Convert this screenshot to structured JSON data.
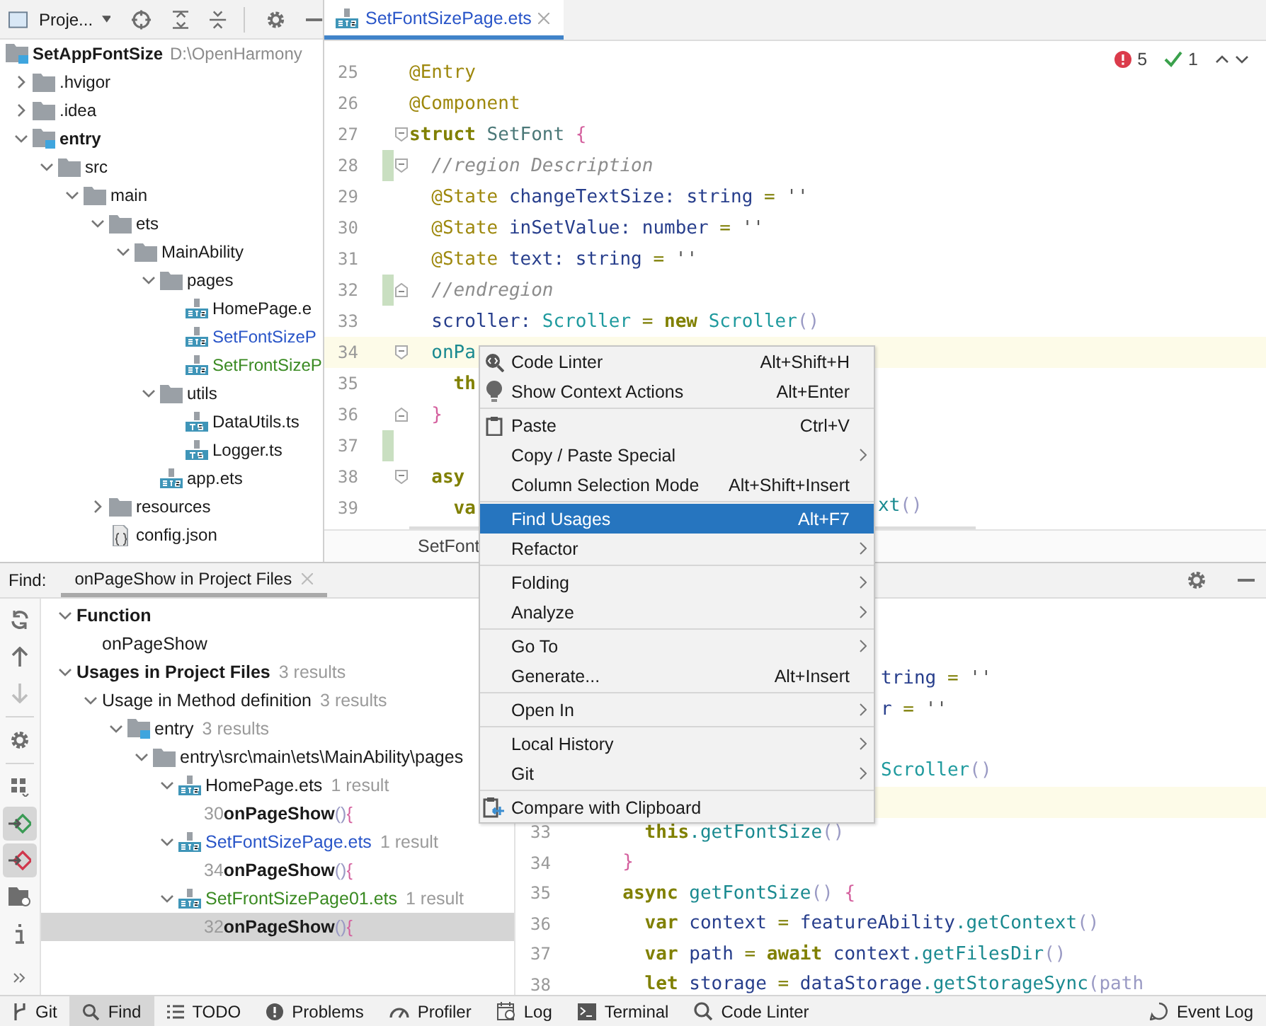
{
  "project": {
    "title": "Proje...",
    "tree": [
      {
        "name": "SetAppFontSize",
        "kind": "project",
        "path": "D:\\OpenHarmony",
        "color": "#1a1a1a",
        "children": [
          {
            "name": ".hvigor",
            "kind": "folder",
            "color": "#1a1a1a",
            "expanded": false
          },
          {
            "name": ".idea",
            "kind": "folder",
            "color": "#1a1a1a",
            "expanded": false
          },
          {
            "name": "entry",
            "kind": "module",
            "color": "#1a1a1a",
            "expanded": true,
            "children": [
              {
                "name": "src",
                "kind": "folder",
                "color": "#1a1a1a",
                "expanded": true,
                "children": [
                  {
                    "name": "main",
                    "kind": "folder",
                    "color": "#1a1a1a",
                    "expanded": true,
                    "children": [
                      {
                        "name": "ets",
                        "kind": "folder",
                        "color": "#1a1a1a",
                        "expanded": true,
                        "children": [
                          {
                            "name": "MainAbility",
                            "kind": "folder",
                            "color": "#1a1a1a",
                            "expanded": true,
                            "children": [
                              {
                                "name": "pages",
                                "kind": "folder",
                                "color": "#1a1a1a",
                                "expanded": true,
                                "children": [
                                  {
                                    "name": "HomePage.e",
                                    "kind": "ets",
                                    "color": "#1a1a1a"
                                  },
                                  {
                                    "name": "SetFontSizeP",
                                    "kind": "ets",
                                    "color": "#2955c8"
                                  },
                                  {
                                    "name": "SetFrontSizeP",
                                    "kind": "ets",
                                    "color": "#3a8a22"
                                  }
                                ]
                              },
                              {
                                "name": "utils",
                                "kind": "folder",
                                "color": "#1a1a1a",
                                "expanded": true,
                                "children": [
                                  {
                                    "name": "DataUtils.ts",
                                    "kind": "ts",
                                    "color": "#1a1a1a"
                                  },
                                  {
                                    "name": "Logger.ts",
                                    "kind": "ts",
                                    "color": "#1a1a1a"
                                  }
                                ]
                              },
                              {
                                "name": "app.ets",
                                "kind": "ets",
                                "color": "#1a1a1a"
                              }
                            ]
                          }
                        ]
                      },
                      {
                        "name": "resources",
                        "kind": "folder",
                        "color": "#1a1a1a",
                        "expanded": false
                      },
                      {
                        "name": "config.json",
                        "kind": "json",
                        "color": "#1a1a1a"
                      }
                    ]
                  }
                ]
              }
            ]
          }
        ]
      }
    ]
  },
  "editor": {
    "tabs": [
      {
        "label": "SetFontSizePage.ets",
        "selected": true
      }
    ],
    "inspections": {
      "errors": "5",
      "checks": "1"
    },
    "lines": [
      {
        "n": "25",
        "code": [
          {
            "text": "@Entry",
            "kind": "dec"
          }
        ]
      },
      {
        "n": "26",
        "code": [
          {
            "text": "@Component",
            "kind": "dec"
          }
        ]
      },
      {
        "n": "27",
        "fold_open": true,
        "code": [
          {
            "text": "struct ",
            "kind": "kw"
          },
          {
            "text": "SetFont ",
            "kind": "name"
          },
          {
            "text": "{",
            "kind": "brace"
          }
        ]
      },
      {
        "n": "28",
        "fold_open": true,
        "changed": true,
        "code": [
          {
            "text": "  //region Description",
            "kind": "cm"
          }
        ]
      },
      {
        "n": "29",
        "code": [
          {
            "text": "  @State ",
            "kind": "dec"
          },
          {
            "text": "changeTextSize: ",
            "kind": "id"
          },
          {
            "text": "string",
            "kind": "type"
          },
          {
            "text": " = ",
            "kind": "op"
          },
          {
            "text": "''",
            "kind": "str"
          }
        ]
      },
      {
        "n": "30",
        "code": [
          {
            "text": "  @State ",
            "kind": "dec"
          },
          {
            "text": "inSetValue: ",
            "kind": "id"
          },
          {
            "text": "number",
            "kind": "type"
          },
          {
            "text": " = ",
            "kind": "op"
          },
          {
            "text": "''",
            "kind": "str"
          }
        ]
      },
      {
        "n": "31",
        "code": [
          {
            "text": "  @State ",
            "kind": "dec"
          },
          {
            "text": "text: ",
            "kind": "id"
          },
          {
            "text": "string",
            "kind": "type"
          },
          {
            "text": " = ",
            "kind": "op"
          },
          {
            "text": "''",
            "kind": "str"
          }
        ]
      },
      {
        "n": "32",
        "fold_close": true,
        "changed": true,
        "code": [
          {
            "text": "  //endregion",
            "kind": "cm"
          }
        ]
      },
      {
        "n": "33",
        "code": [
          {
            "text": "  scroller: ",
            "kind": "id"
          },
          {
            "text": "Scroller",
            "kind": "cls"
          },
          {
            "text": " = ",
            "kind": "op"
          },
          {
            "text": "new ",
            "kind": "kw"
          },
          {
            "text": "Scroller",
            "kind": "cls"
          },
          {
            "text": "()",
            "kind": "paren"
          }
        ]
      },
      {
        "n": "34",
        "fold_open": true,
        "current": true,
        "code": [
          {
            "text": "  onPa",
            "kind": "fn"
          }
        ]
      },
      {
        "n": "35",
        "code": [
          {
            "text": "    th",
            "kind": "kw"
          }
        ]
      },
      {
        "n": "36",
        "fold_close": true,
        "code": [
          {
            "text": "  }",
            "kind": "brace"
          }
        ]
      },
      {
        "n": "37",
        "changed": true
      },
      {
        "n": "38",
        "fold_open": true,
        "code": [
          {
            "text": "  asy",
            "kind": "kw"
          }
        ]
      },
      {
        "n": "39",
        "code": [
          {
            "text": "    va",
            "kind": "kw"
          }
        ],
        "after_menu": [
          {
            "text": "xt",
            "kind": "fn"
          },
          {
            "text": "()",
            "kind": "paren"
          }
        ]
      }
    ],
    "breadcrumb": "SetFont"
  },
  "find": {
    "label": "Find:",
    "tabs": [
      {
        "label": "onPageShow in Project Files",
        "selected": true
      }
    ],
    "toolbar": [
      {
        "kind": "rerun",
        "selected": false,
        "disabled": false
      },
      {
        "kind": "up",
        "selected": false,
        "disabled": false
      },
      {
        "kind": "down",
        "selected": false,
        "disabled": true
      },
      {
        "kind": "settings",
        "selected": false,
        "disabled": false
      },
      {
        "kind": "group",
        "selected": false,
        "disabled": false
      },
      {
        "kind": "read",
        "selected": true,
        "disabled": false
      },
      {
        "kind": "write",
        "selected": true,
        "disabled": false
      },
      {
        "kind": "folder",
        "selected": false,
        "disabled": false
      },
      {
        "kind": "info",
        "selected": false,
        "disabled": false
      }
    ],
    "results": [
      {
        "kind": "category",
        "label": "Function",
        "expanded": true,
        "selected": false,
        "children": [
          {
            "label": "onPageShow",
            "selected": false
          }
        ]
      },
      {
        "kind": "category",
        "label": "Usages in Project Files",
        "count": "3 results",
        "expanded": true,
        "selected": false,
        "children": [
          {
            "label": "Usage in Method definition",
            "count": "3 results",
            "expanded": true,
            "selected": false,
            "children": [
              {
                "kind": "module",
                "label": "entry",
                "count": "3 results",
                "expanded": true,
                "selected": false,
                "children": [
                  {
                    "kind": "folder",
                    "label": "entry\\src\\main\\ets\\MainAbility\\pages",
                    "expanded": true,
                    "selected": false,
                    "children": [
                      {
                        "kind": "ets",
                        "label": "HomePage.ets",
                        "color": "#1a1a1a",
                        "count": "1 result",
                        "expanded": true,
                        "selected": false,
                        "children": [
                          {
                            "kind": "usage",
                            "line": "30",
                            "match": "onPageShow",
                            "paren": "()",
                            "brace": "{",
                            "selected": false
                          }
                        ]
                      },
                      {
                        "kind": "ets",
                        "label": "SetFontSizePage.ets",
                        "color": "#2955c8",
                        "count": "1 result",
                        "expanded": true,
                        "selected": false,
                        "children": [
                          {
                            "kind": "usage",
                            "line": "34",
                            "match": "onPageShow",
                            "paren": "()",
                            "brace": "{",
                            "selected": false
                          }
                        ]
                      },
                      {
                        "kind": "ets",
                        "label": "SetFrontSizePage01.ets",
                        "color": "#3a8a22",
                        "count": "1 result",
                        "expanded": true,
                        "selected": false,
                        "children": [
                          {
                            "kind": "usage",
                            "line": "32",
                            "match": "onPageShow",
                            "paren": "()",
                            "brace": "{",
                            "selected": true
                          }
                        ]
                      }
                    ]
                  }
                ]
              }
            ]
          }
        ]
      }
    ],
    "preview": [
      {
        "current": false,
        "after_menu": [
          {
            "text": "tring",
            "kind": "type"
          },
          {
            "text": " = ",
            "kind": "op"
          },
          {
            "text": "''",
            "kind": "str"
          }
        ]
      },
      {
        "current": false,
        "after_menu": [
          {
            "text": "r",
            "kind": "type"
          },
          {
            "text": " = ",
            "kind": "op"
          },
          {
            "text": "''",
            "kind": "str"
          }
        ]
      },
      {
        "current": false
      },
      {
        "current": false,
        "after_menu": [
          {
            "text": "Scroller",
            "kind": "cls"
          },
          {
            "text": "()",
            "kind": "paren"
          }
        ]
      },
      {
        "current": true
      },
      {
        "n": "33",
        "current": false,
        "code": [
          {
            "text": "    this",
            "kind": "kw"
          },
          {
            "text": ".getFontSize",
            "kind": "fn"
          },
          {
            "text": "()",
            "kind": "paren"
          }
        ]
      },
      {
        "n": "34",
        "current": false,
        "code": [
          {
            "text": "  }",
            "kind": "brace"
          }
        ]
      },
      {
        "n": "35",
        "current": false,
        "code": [
          {
            "text": "  async ",
            "kind": "kw"
          },
          {
            "text": "getFontSize",
            "kind": "fn"
          },
          {
            "text": "() ",
            "kind": "paren"
          },
          {
            "text": "{",
            "kind": "brace"
          }
        ]
      },
      {
        "n": "36",
        "current": false,
        "code": [
          {
            "text": "    var ",
            "kind": "kw"
          },
          {
            "text": "context ",
            "kind": "id"
          },
          {
            "text": "= ",
            "kind": "op"
          },
          {
            "text": "featureAbility",
            "kind": "id"
          },
          {
            "text": ".getContext",
            "kind": "fn"
          },
          {
            "text": "()",
            "kind": "paren"
          }
        ]
      },
      {
        "n": "37",
        "current": false,
        "code": [
          {
            "text": "    var ",
            "kind": "kw"
          },
          {
            "text": "path ",
            "kind": "id"
          },
          {
            "text": "= ",
            "kind": "op"
          },
          {
            "text": "await ",
            "kind": "kw"
          },
          {
            "text": "context",
            "kind": "id"
          },
          {
            "text": ".getFilesDir",
            "kind": "fn"
          },
          {
            "text": "()",
            "kind": "paren"
          }
        ]
      },
      {
        "n": "38",
        "current": false,
        "code": [
          {
            "text": "    let ",
            "kind": "kw"
          },
          {
            "text": "storage ",
            "kind": "id"
          },
          {
            "text": "= ",
            "kind": "op"
          },
          {
            "text": "dataStorage",
            "kind": "id"
          },
          {
            "text": ".getStorageSync",
            "kind": "fn"
          },
          {
            "text": "(path",
            "kind": "paren"
          }
        ]
      }
    ]
  },
  "context_menu": {
    "groups": [
      [
        {
          "kind": "linter",
          "label": "Code Linter",
          "shortcut": "Alt+Shift+H",
          "submenu": false,
          "selected": false
        },
        {
          "kind": "bulb",
          "label": "Show Context Actions",
          "shortcut": "Alt+Enter",
          "submenu": false,
          "selected": false
        }
      ],
      [
        {
          "kind": "paste",
          "label": "Paste",
          "shortcut": "Ctrl+V",
          "submenu": false,
          "selected": false
        },
        {
          "kind": "plain",
          "label": "Copy / Paste Special",
          "submenu": true,
          "selected": false
        },
        {
          "kind": "plain",
          "label": "Column Selection Mode",
          "shortcut": "Alt+Shift+Insert",
          "submenu": false,
          "selected": false
        }
      ],
      [
        {
          "kind": "plain",
          "label": "Find Usages",
          "shortcut": "Alt+F7",
          "submenu": false,
          "selected": true
        },
        {
          "kind": "plain",
          "label": "Refactor",
          "submenu": true,
          "selected": false
        }
      ],
      [
        {
          "kind": "plain",
          "label": "Folding",
          "submenu": true,
          "selected": false
        },
        {
          "kind": "plain",
          "label": "Analyze",
          "submenu": true,
          "selected": false
        }
      ],
      [
        {
          "kind": "plain",
          "label": "Go To",
          "submenu": true,
          "selected": false
        },
        {
          "kind": "plain",
          "label": "Generate...",
          "shortcut": "Alt+Insert",
          "submenu": false,
          "selected": false
        }
      ],
      [
        {
          "kind": "plain",
          "label": "Open In",
          "submenu": true,
          "selected": false
        }
      ],
      [
        {
          "kind": "plain",
          "label": "Local History",
          "submenu": true,
          "selected": false
        },
        {
          "kind": "plain",
          "label": "Git",
          "submenu": true,
          "selected": false
        }
      ],
      [
        {
          "kind": "compare",
          "label": "Compare with Clipboard",
          "submenu": false,
          "selected": false
        }
      ]
    ]
  },
  "status_bar": {
    "items": [
      {
        "kind": "git",
        "label": "Git",
        "selected": false
      },
      {
        "kind": "find",
        "label": "Find",
        "selected": true
      },
      {
        "kind": "todo",
        "label": "TODO",
        "selected": false
      },
      {
        "kind": "problems",
        "label": "Problems",
        "selected": false
      },
      {
        "kind": "profiler",
        "label": "Profiler",
        "selected": false
      },
      {
        "kind": "log",
        "label": "Log",
        "selected": false
      },
      {
        "kind": "terminal",
        "label": "Terminal",
        "selected": false
      },
      {
        "kind": "linter",
        "label": "Code Linter",
        "selected": false
      }
    ],
    "right": [
      {
        "kind": "event",
        "label": "Event Log",
        "selected": false
      }
    ]
  }
}
